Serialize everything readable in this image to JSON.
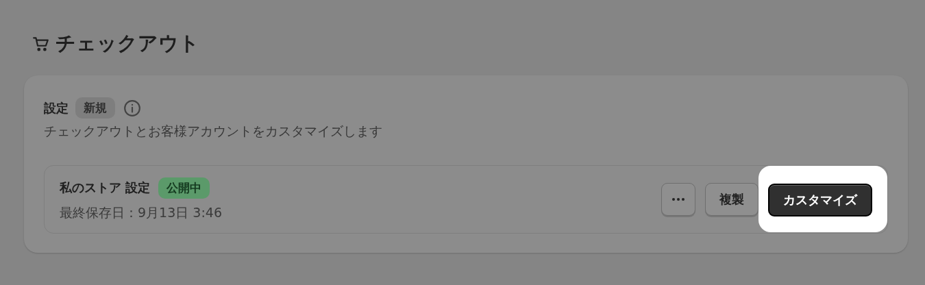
{
  "page": {
    "title": "チェックアウト"
  },
  "settings": {
    "heading": "設定",
    "badge": "新規",
    "description": "チェックアウトとお客様アカウントをカスタマイズします",
    "theme": {
      "name": "私のストア 設定",
      "status": "公開中",
      "saved": "最終保存日：9月13日 3:46",
      "actions": [
        {
          "kind": "more"
        },
        {
          "kind": "secondary",
          "label": "複製",
          "highlighted": false
        },
        {
          "kind": "primary",
          "label": "カスタマイズ",
          "highlighted": true
        }
      ]
    }
  }
}
